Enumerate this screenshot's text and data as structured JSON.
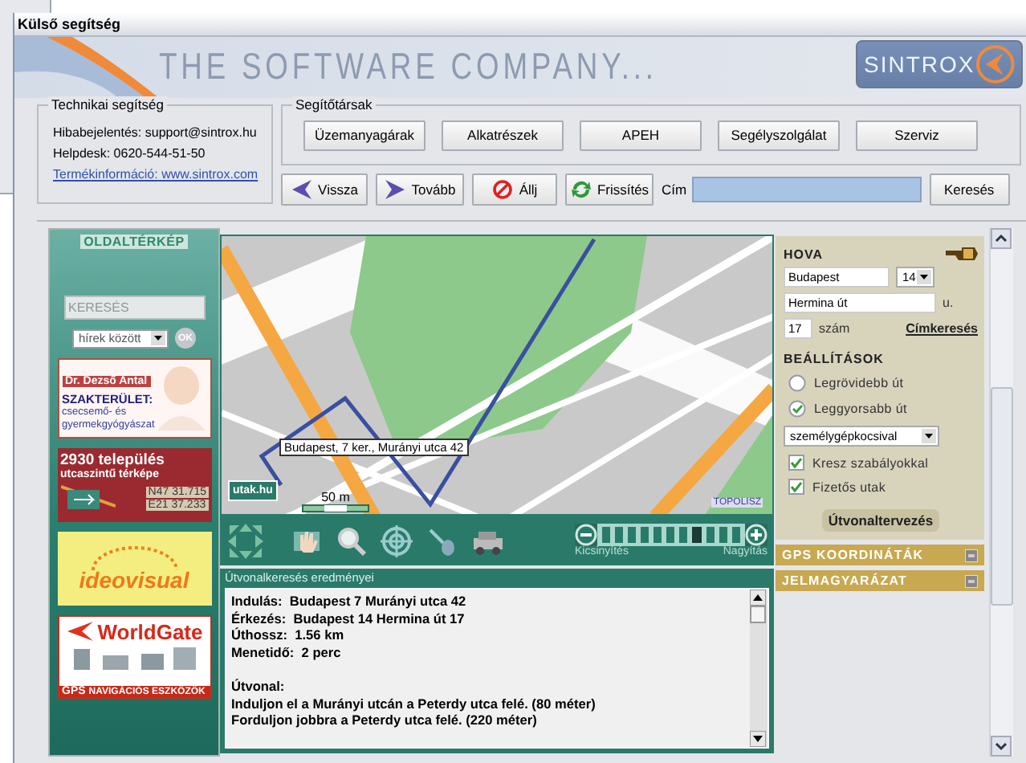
{
  "window": {
    "title": "Külső segítség"
  },
  "banner": {
    "slogan": "THE SOFTWARE COMPANY...",
    "logo": "SINTROX"
  },
  "support": {
    "title": "Technikai segítség",
    "lines": [
      "Hibabejelentés: support@sintrox.hu",
      "Helpdesk: 0620-544-51-50"
    ],
    "link": "Termékinformáció: www.sintrox.com"
  },
  "partners": {
    "title": "Segítőtársak",
    "buttons": [
      "Üzemanyagárak",
      "Alkatrészek",
      "APEH",
      "Segélyszolgálat",
      "Szerviz"
    ]
  },
  "nav": {
    "buttons": [
      {
        "kind": "back",
        "label": "Vissza"
      },
      {
        "kind": "forward",
        "label": "Tovább"
      },
      {
        "kind": "stop",
        "label": "Állj"
      },
      {
        "kind": "refresh",
        "label": "Frissítés"
      }
    ],
    "address_label": "Cím",
    "search_button": "Keresés"
  },
  "sidebar": {
    "title": "OLDALTÉRKÉP",
    "search": {
      "placeholder": "KERESÉS"
    },
    "scope": "hírek között",
    "ok": "OK",
    "ads": [
      {
        "kind": "doctor",
        "lines": [
          "Dr. Dezső Antal",
          "SZAKTERÜLET:",
          "csecsemő- és",
          "gyermekgyógyászat"
        ]
      },
      {
        "kind": "atlas",
        "lines": [
          "2930 település",
          "utcaszintű térképe",
          "N47 31.715",
          "E21 37.233"
        ]
      },
      {
        "kind": "studio",
        "lines": [
          "ideovisual"
        ]
      },
      {
        "kind": "gps",
        "lines": [
          "WorldGate",
          "GPS",
          "NAVIGÁCIÓS ESZKÖZÖK"
        ]
      }
    ]
  },
  "map": {
    "marker_label": "Budapest, 7 ker., Murányi utca 42",
    "scale": "50 m",
    "logo": "utak.hu",
    "credit": "TOPOLISZ"
  },
  "map_tools": {
    "zoom_out": "Kicsinyítés",
    "zoom_in": "Nagyítás",
    "steps": [
      {
        "selected": false
      },
      {
        "selected": false
      },
      {
        "selected": false
      },
      {
        "selected": false
      },
      {
        "selected": false
      },
      {
        "selected": false
      },
      {
        "selected": false
      },
      {
        "selected": true
      },
      {
        "selected": false
      },
      {
        "selected": false
      },
      {
        "selected": false
      }
    ]
  },
  "results": {
    "title": "Útvonalkeresés eredményei",
    "summary": [
      "Indulás:  Budapest 7 Murányi utca 42",
      "Érkezés:  Budapest 14 Hermina út 17",
      "Úthossz:  1.56 km",
      "Menetidő:  2 perc"
    ],
    "route_title": "Útvonal:",
    "steps": [
      "Induljon el a Murányi utcán a Peterdy utca felé. (80 méter)",
      "Forduljon jobbra a Peterdy utca felé. (220 méter)"
    ]
  },
  "route_form": {
    "title": "HOVA",
    "city": "Budapest",
    "district": "14",
    "street": "Hermina út",
    "street_suffix": "u.",
    "number": "17",
    "number_label": "szám",
    "address_search": "Címkeresés",
    "settings_title": "BEÁLLÍTÁSOK",
    "modes": [
      {
        "label": "Legrövidebb út",
        "selected": false
      },
      {
        "label": "Leggyorsabb út",
        "selected": true
      }
    ],
    "vehicle": "személygépkocsival",
    "options": [
      {
        "label": "Kresz szabályokkal",
        "checked": true
      },
      {
        "label": "Fizetős utak",
        "checked": true
      }
    ],
    "plan_button": "Útvonaltervezés"
  },
  "sections": [
    "GPS KOORDINÁTÁK",
    "JELMAGYARÁZAT"
  ]
}
